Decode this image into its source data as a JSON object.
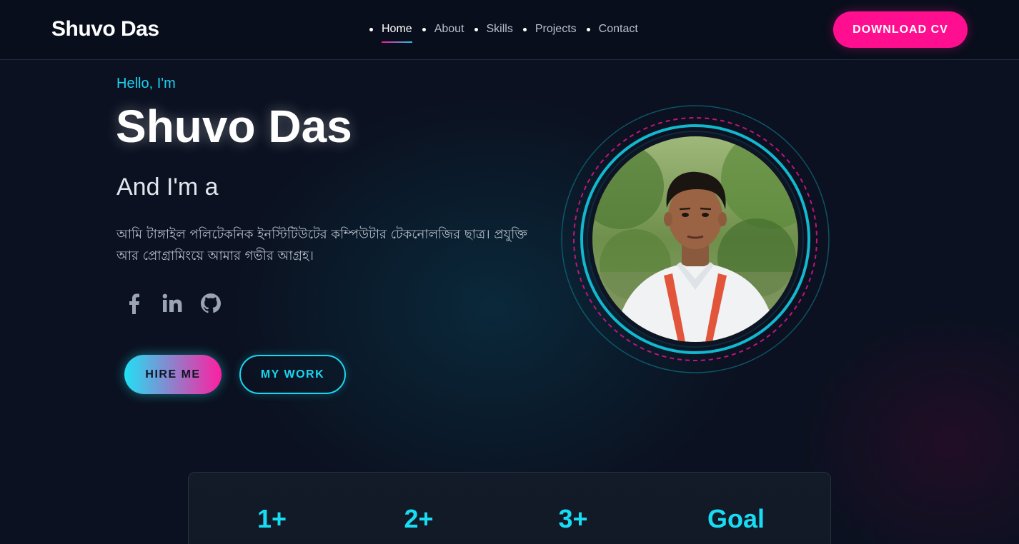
{
  "header": {
    "logo": "Shuvo Das",
    "nav": [
      "Home",
      "About",
      "Skills",
      "Projects",
      "Contact"
    ],
    "active_nav": "Home",
    "download_cv": "DOWNLOAD CV"
  },
  "hero": {
    "greeting": "Hello, I'm",
    "name": "Shuvo Das",
    "role_prefix": "And I'm a",
    "bio": "আমি টাঙ্গাইল পলিটেকনিক ইনস্টিটিউটের কম্পিউটার টেকনোলজির ছাত্র। প্রযুক্তি আর প্রোগ্রামিংয়ে আমার গভীর আগ্রহ।",
    "socials": [
      "facebook-icon",
      "linkedin-icon",
      "github-icon"
    ],
    "hire_button": "HIRE ME",
    "work_button": "MY WORK"
  },
  "stats": {
    "items": [
      "1+",
      "2+",
      "3+",
      "Goal"
    ]
  },
  "colors": {
    "accent_cyan": "#18dcf3",
    "accent_pink": "#ff0f8f",
    "background": "#0b1120"
  }
}
